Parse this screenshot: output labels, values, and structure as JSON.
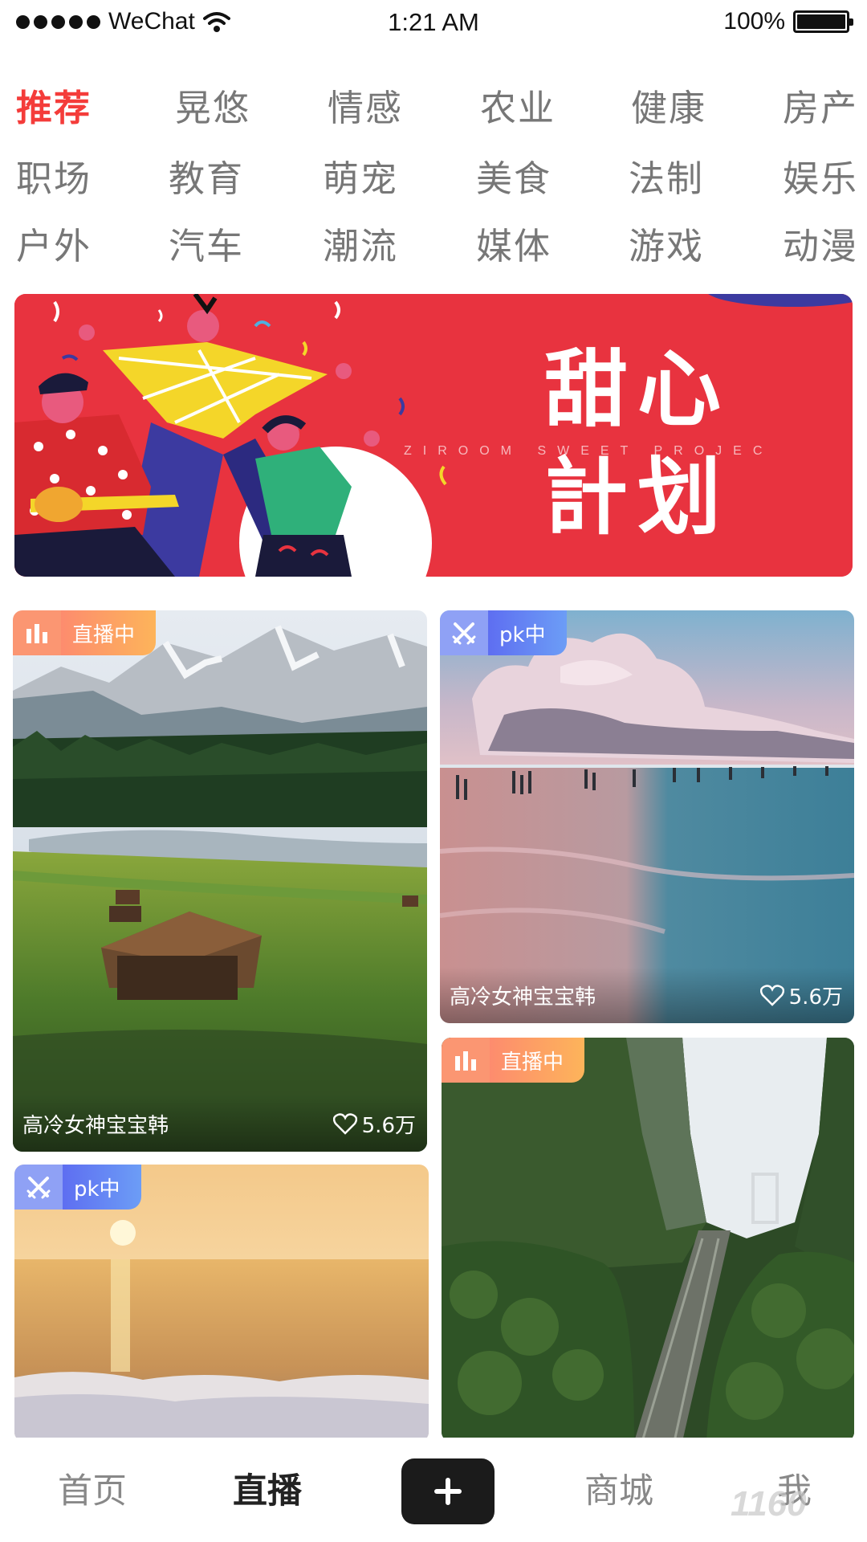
{
  "status_bar": {
    "carrier": "WeChat",
    "time": "1:21 AM",
    "battery": "100%"
  },
  "categories": [
    [
      "推荐",
      "晃悠",
      "情感",
      "农业",
      "健康",
      "房产"
    ],
    [
      "职场",
      "教育",
      "萌宠",
      "美食",
      "法制",
      "娱乐"
    ],
    [
      "户外",
      "汽车",
      "潮流",
      "媒体",
      "游戏",
      "动漫"
    ]
  ],
  "active_category": "推荐",
  "banner": {
    "title_line1": "甜心",
    "title_line2": "計划",
    "subtitle": "ZIROOM SWEET PROJEC"
  },
  "cards": [
    {
      "badge": "直播中",
      "badge_type": "live",
      "author": "高冷女神宝宝韩",
      "likes": "5.6万",
      "scene": "mountain-lake-meadow"
    },
    {
      "badge": "pk中",
      "badge_type": "pk",
      "author": "高冷女神宝宝韩",
      "likes": "5.6万",
      "scene": "pink-clouds-sea"
    },
    {
      "badge": "pk中",
      "badge_type": "pk",
      "scene": "sunset-sea"
    },
    {
      "badge": "直播中",
      "badge_type": "live",
      "scene": "green-gorge-stairs"
    }
  ],
  "bottom_nav": {
    "home": "首页",
    "live": "直播",
    "mall": "商城",
    "me": "我",
    "watermark": "1160"
  },
  "icons": {
    "plus": "plus-icon",
    "live": "bar-chart-icon",
    "pk": "crossed-swords-icon",
    "heart": "heart-icon"
  },
  "colors": {
    "accent": "#f43c3a",
    "banner": "#e8333f",
    "live_badge": "#fd8c6e",
    "pk_badge": "#5e6ef1"
  }
}
